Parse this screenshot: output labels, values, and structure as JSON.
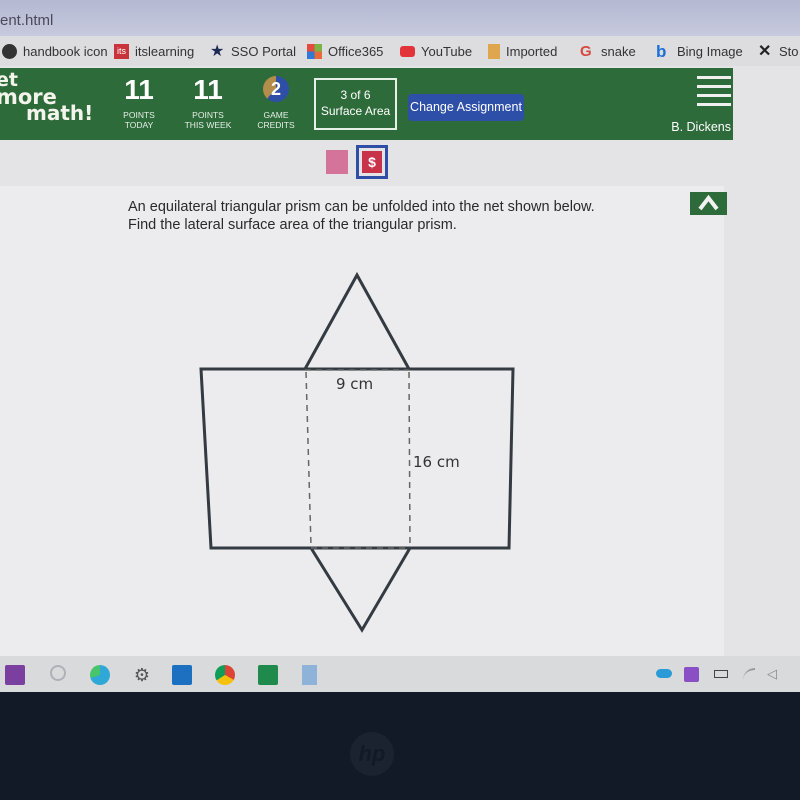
{
  "browser": {
    "url_fragment": "ent.html",
    "bookmarks": [
      {
        "label": "handbook icon",
        "icon": "handbook-icon"
      },
      {
        "label": "itslearning",
        "icon": "itslearning-icon",
        "icon_text": "its"
      },
      {
        "label": "SSO Portal",
        "icon": "star-icon"
      },
      {
        "label": "Office365",
        "icon": "office-icon"
      },
      {
        "label": "YouTube",
        "icon": "youtube-icon"
      },
      {
        "label": "Imported",
        "icon": "folder-icon"
      },
      {
        "label": "snake",
        "icon": "google-icon",
        "icon_text": "G"
      },
      {
        "label": "Bing Image",
        "icon": "bing-icon",
        "icon_text": "b"
      },
      {
        "label": "Sto",
        "icon": "x-icon",
        "icon_text": "✕"
      }
    ]
  },
  "header": {
    "logo": {
      "line1": "et",
      "line2": "more",
      "line3": "math!"
    },
    "points_today": {
      "value": "11",
      "label_1": "POINTS",
      "label_2": "TODAY"
    },
    "points_week": {
      "value": "11",
      "label_1": "POINTS",
      "label_2": "THIS WEEK"
    },
    "game_credits": {
      "value": "2",
      "label_1": "GAME",
      "label_2": "CREDITS"
    },
    "assignment": {
      "progress": "3 of 6",
      "topic": "Surface Area"
    },
    "change_assignment_label": "Change Assignment",
    "user_name": "B. Dickens"
  },
  "tools": {
    "dollar_label": "$"
  },
  "problem": {
    "text": "An equilateral triangular prism can be unfolded into the net shown below. Find the lateral surface area of the triangular prism.",
    "net": {
      "base_label": "9 cm",
      "height_label": "16 cm"
    }
  },
  "colors": {
    "header_green": "#2e6b3a",
    "button_blue": "#2d4fa8",
    "dollar_red": "#c9334a",
    "pink": "#d5749a"
  },
  "taskbar": {
    "apps": [
      "onenote-icon",
      "snipping-icon",
      "edge-icon",
      "settings-icon",
      "outlook-icon",
      "chrome-icon",
      "excel-icon",
      "calculator-icon"
    ],
    "tray": [
      "onedrive-icon",
      "onenote-tray-icon",
      "battery-icon",
      "wifi-icon",
      "volume-icon"
    ]
  },
  "bezel": {
    "brand": "hp"
  }
}
